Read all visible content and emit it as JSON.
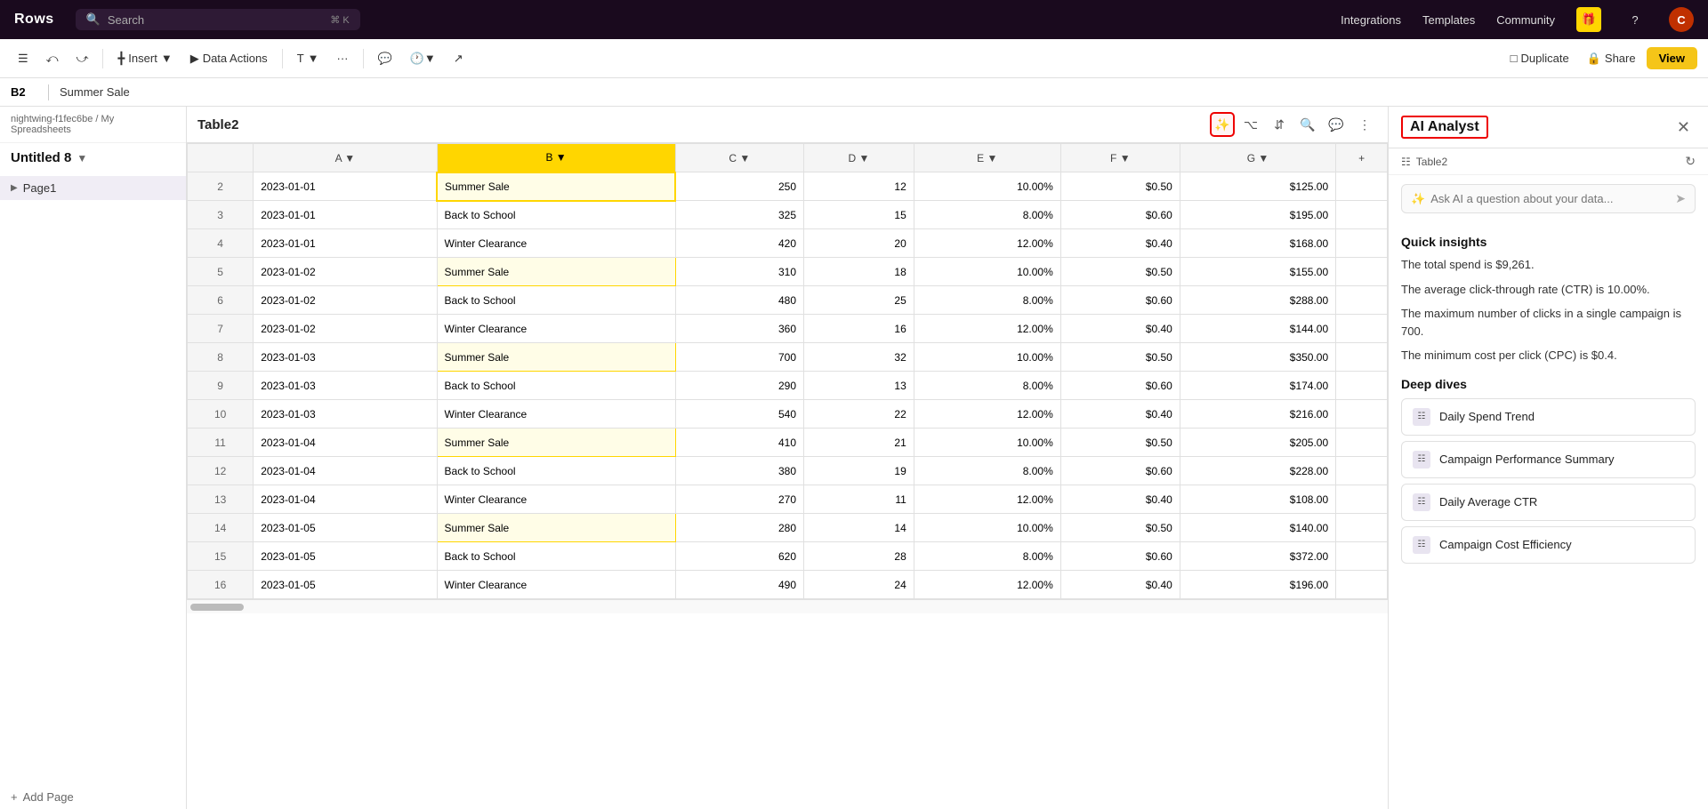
{
  "app": {
    "brand": "Rows",
    "nav_links": [
      "Integrations",
      "Templates",
      "Community"
    ],
    "avatar_letter": "C",
    "search_placeholder": "Search",
    "search_shortcut": "⌘ K"
  },
  "toolbar": {
    "undo_label": "↺",
    "redo_label": "↻",
    "insert_label": "Insert",
    "data_actions_label": "Data Actions",
    "format_label": "T",
    "more_label": "···",
    "comment_label": "💬",
    "history_label": "🕐",
    "trending_label": "↗",
    "duplicate_label": "Duplicate",
    "share_label": "Share",
    "view_label": "View"
  },
  "cell_ref": {
    "ref": "B2",
    "value": "Summer Sale"
  },
  "sidebar": {
    "breadcrumb": "nightwing-f1fec6be / My Spreadsheets",
    "breadcrumb_part1": "nightwing-f1fec6be",
    "breadcrumb_part2": "My Spreadsheets",
    "title": "Untitled 8",
    "pages": [
      {
        "label": "Page1",
        "active": true
      }
    ],
    "add_page_label": "Add Page"
  },
  "sheet": {
    "title": "Table2",
    "columns": [
      {
        "id": "row",
        "label": ""
      },
      {
        "id": "A",
        "label": "A"
      },
      {
        "id": "B",
        "label": "B"
      },
      {
        "id": "C",
        "label": "C"
      },
      {
        "id": "D",
        "label": "D"
      },
      {
        "id": "E",
        "label": "E"
      },
      {
        "id": "F",
        "label": "F"
      },
      {
        "id": "G",
        "label": "G"
      },
      {
        "id": "add",
        "label": "+"
      }
    ],
    "rows": [
      {
        "num": "2",
        "A": "2023-01-01",
        "B": "Summer Sale",
        "C": "250",
        "D": "12",
        "E": "10.00%",
        "F": "$0.50",
        "G": "$125.00",
        "active": true
      },
      {
        "num": "3",
        "A": "2023-01-01",
        "B": "Back to School",
        "C": "325",
        "D": "15",
        "E": "8.00%",
        "F": "$0.60",
        "G": "$195.00"
      },
      {
        "num": "4",
        "A": "2023-01-01",
        "B": "Winter Clearance",
        "C": "420",
        "D": "20",
        "E": "12.00%",
        "F": "$0.40",
        "G": "$168.00"
      },
      {
        "num": "5",
        "A": "2023-01-02",
        "B": "Summer Sale",
        "C": "310",
        "D": "18",
        "E": "10.00%",
        "F": "$0.50",
        "G": "$155.00"
      },
      {
        "num": "6",
        "A": "2023-01-02",
        "B": "Back to School",
        "C": "480",
        "D": "25",
        "E": "8.00%",
        "F": "$0.60",
        "G": "$288.00"
      },
      {
        "num": "7",
        "A": "2023-01-02",
        "B": "Winter Clearance",
        "C": "360",
        "D": "16",
        "E": "12.00%",
        "F": "$0.40",
        "G": "$144.00"
      },
      {
        "num": "8",
        "A": "2023-01-03",
        "B": "Summer Sale",
        "C": "700",
        "D": "32",
        "E": "10.00%",
        "F": "$0.50",
        "G": "$350.00"
      },
      {
        "num": "9",
        "A": "2023-01-03",
        "B": "Back to School",
        "C": "290",
        "D": "13",
        "E": "8.00%",
        "F": "$0.60",
        "G": "$174.00"
      },
      {
        "num": "10",
        "A": "2023-01-03",
        "B": "Winter Clearance",
        "C": "540",
        "D": "22",
        "E": "12.00%",
        "F": "$0.40",
        "G": "$216.00"
      },
      {
        "num": "11",
        "A": "2023-01-04",
        "B": "Summer Sale",
        "C": "410",
        "D": "21",
        "E": "10.00%",
        "F": "$0.50",
        "G": "$205.00"
      },
      {
        "num": "12",
        "A": "2023-01-04",
        "B": "Back to School",
        "C": "380",
        "D": "19",
        "E": "8.00%",
        "F": "$0.60",
        "G": "$228.00"
      },
      {
        "num": "13",
        "A": "2023-01-04",
        "B": "Winter Clearance",
        "C": "270",
        "D": "11",
        "E": "12.00%",
        "F": "$0.40",
        "G": "$108.00"
      },
      {
        "num": "14",
        "A": "2023-01-05",
        "B": "Summer Sale",
        "C": "280",
        "D": "14",
        "E": "10.00%",
        "F": "$0.50",
        "G": "$140.00"
      },
      {
        "num": "15",
        "A": "2023-01-05",
        "B": "Back to School",
        "C": "620",
        "D": "28",
        "E": "8.00%",
        "F": "$0.60",
        "G": "$372.00"
      },
      {
        "num": "16",
        "A": "2023-01-05",
        "B": "Winter Clearance",
        "C": "490",
        "D": "24",
        "E": "12.00%",
        "F": "$0.40",
        "G": "$196.00"
      }
    ]
  },
  "ai_panel": {
    "title": "AI Analyst",
    "close_label": "✕",
    "table_ref": "Table2",
    "ask_placeholder": "Ask AI a question about your data...",
    "quick_insights_title": "Quick insights",
    "insights": [
      "The total spend is $9,261.",
      "The average click-through rate (CTR) is 10.00%.",
      "The maximum number of clicks in a single campaign is 700.",
      "The minimum cost per click (CPC) is $0.4."
    ],
    "deep_dives_title": "Deep dives",
    "deep_dives": [
      {
        "label": "Daily Spend Trend"
      },
      {
        "label": "Campaign Performance Summary"
      },
      {
        "label": "Daily Average CTR"
      },
      {
        "label": "Campaign Cost Efficiency"
      }
    ]
  }
}
